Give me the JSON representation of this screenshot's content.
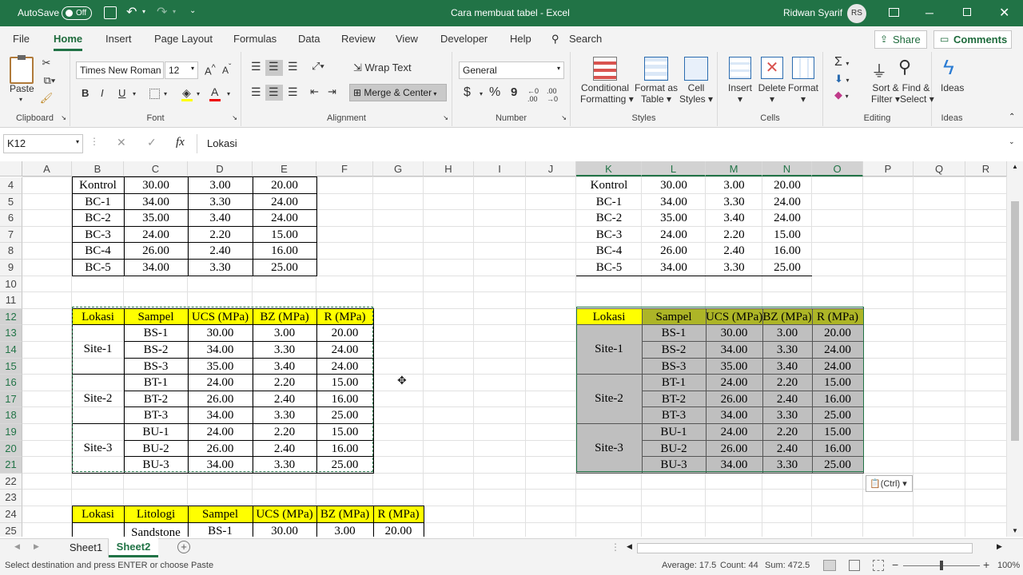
{
  "titlebar": {
    "autosave": "AutoSave",
    "autosave_state": "Off",
    "doc_title": "Cara membuat tabel  -  Excel",
    "user": "Ridwan Syarif",
    "initials": "RS"
  },
  "tabs": [
    "File",
    "Home",
    "Insert",
    "Page Layout",
    "Formulas",
    "Data",
    "Review",
    "View",
    "Developer",
    "Help"
  ],
  "search_label": "Search",
  "share_label": "Share",
  "comments_label": "Comments",
  "ribbon": {
    "clipboard": {
      "label": "Clipboard",
      "paste": "Paste"
    },
    "font": {
      "label": "Font",
      "name": "Times New Roman",
      "size": "12",
      "bold": "B",
      "italic": "I",
      "underline": "U"
    },
    "alignment": {
      "label": "Alignment",
      "wrap": "Wrap Text",
      "merge": "Merge & Center"
    },
    "number": {
      "label": "Number",
      "format": "General",
      "currency": "$",
      "percent": "%",
      "comma": "9"
    },
    "styles": {
      "label": "Styles",
      "cond1": "Conditional",
      "cond2": "Formatting",
      "fmt1": "Format as",
      "fmt2": "Table",
      "cell1": "Cell",
      "cell2": "Styles"
    },
    "cells": {
      "label": "Cells",
      "insert": "Insert",
      "delete": "Delete",
      "format": "Format"
    },
    "editing": {
      "label": "Editing",
      "sort1": "Sort &",
      "sort2": "Filter",
      "find1": "Find &",
      "find2": "Select"
    },
    "ideas": {
      "label": "Ideas",
      "btn": "Ideas"
    }
  },
  "formula_bar": {
    "name_box": "K12",
    "fx": "fx",
    "value": "Lokasi"
  },
  "columns": [
    "A",
    "B",
    "C",
    "D",
    "E",
    "F",
    "G",
    "H",
    "I",
    "J",
    "K",
    "L",
    "M",
    "N",
    "O",
    "P",
    "Q",
    "R"
  ],
  "rows": [
    "4",
    "5",
    "6",
    "7",
    "8",
    "9",
    "10",
    "11",
    "12",
    "13",
    "14",
    "15",
    "16",
    "17",
    "18",
    "19",
    "20",
    "21",
    "22",
    "23",
    "24",
    "25"
  ],
  "table1": {
    "rows": [
      [
        "Kontrol",
        "30.00",
        "3.00",
        "20.00"
      ],
      [
        "BC-1",
        "34.00",
        "3.30",
        "24.00"
      ],
      [
        "BC-2",
        "35.00",
        "3.40",
        "24.00"
      ],
      [
        "BC-3",
        "24.00",
        "2.20",
        "15.00"
      ],
      [
        "BC-4",
        "26.00",
        "2.40",
        "16.00"
      ],
      [
        "BC-5",
        "34.00",
        "3.30",
        "25.00"
      ]
    ]
  },
  "table2": {
    "headers": [
      "Lokasi",
      "Sampel",
      "UCS (MPa)",
      "BZ (MPa)",
      "R (MPa)"
    ],
    "groups": [
      "Site-1",
      "Site-2",
      "Site-3"
    ],
    "rows": [
      [
        "BS-1",
        "30.00",
        "3.00",
        "20.00"
      ],
      [
        "BS-2",
        "34.00",
        "3.30",
        "24.00"
      ],
      [
        "BS-3",
        "35.00",
        "3.40",
        "24.00"
      ],
      [
        "BT-1",
        "24.00",
        "2.20",
        "15.00"
      ],
      [
        "BT-2",
        "26.00",
        "2.40",
        "16.00"
      ],
      [
        "BT-3",
        "34.00",
        "3.30",
        "25.00"
      ],
      [
        "BU-1",
        "24.00",
        "2.20",
        "15.00"
      ],
      [
        "BU-2",
        "26.00",
        "2.40",
        "16.00"
      ],
      [
        "BU-3",
        "34.00",
        "3.30",
        "25.00"
      ]
    ]
  },
  "table3": {
    "headers": [
      "Lokasi",
      "Litologi",
      "Sampel",
      "UCS (MPa)",
      "BZ (MPa)",
      "R (MPa)"
    ],
    "row1": [
      "Sandstone",
      "BS-1",
      "30.00",
      "3.00",
      "20.00"
    ]
  },
  "paste_options": "(Ctrl)",
  "sheets": [
    "Sheet1",
    "Sheet2"
  ],
  "status": {
    "message": "Select destination and press ENTER or choose Paste",
    "average": "Average: 17.5",
    "count": "Count: 44",
    "sum": "Sum: 472.5",
    "zoom": "100%"
  },
  "colors": {
    "brand": "#217346",
    "yellow": "#ffff00",
    "olive": "#adb527",
    "gray": "#bfbfbf"
  }
}
